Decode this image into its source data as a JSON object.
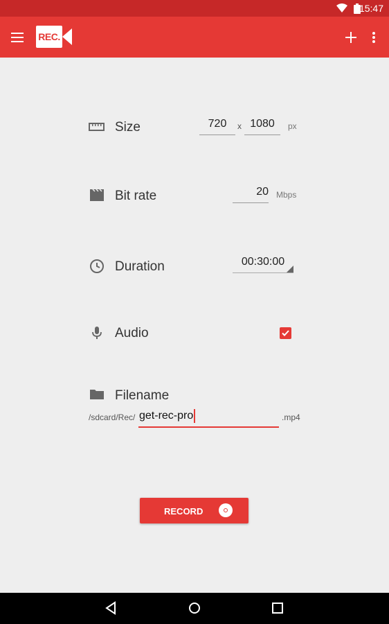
{
  "status_bar": {
    "time": "15:47"
  },
  "app_bar": {
    "logo_text": "REC."
  },
  "form": {
    "size": {
      "label": "Size",
      "width": "720",
      "separator": "x",
      "height": "1080",
      "unit": "px"
    },
    "bit_rate": {
      "label": "Bit rate",
      "value": "20",
      "unit": "Mbps"
    },
    "duration": {
      "label": "Duration",
      "value": "00:30:00"
    },
    "audio": {
      "label": "Audio",
      "checked": true
    },
    "filename": {
      "label": "Filename",
      "prefix": "/sdcard/Rec/",
      "value": "get-rec-pro",
      "extension": ".mp4"
    }
  },
  "record_button": {
    "label": "RECORD"
  },
  "colors": {
    "accent": "#e53935",
    "status_bar": "#c62828",
    "background": "#eeeeee"
  },
  "icons": [
    "menu-icon",
    "add-icon",
    "more-vert-icon",
    "ruler-icon",
    "clapperboard-icon",
    "clock-icon",
    "mic-icon",
    "folder-icon",
    "record-icon",
    "back-icon",
    "home-icon",
    "recents-icon"
  ]
}
